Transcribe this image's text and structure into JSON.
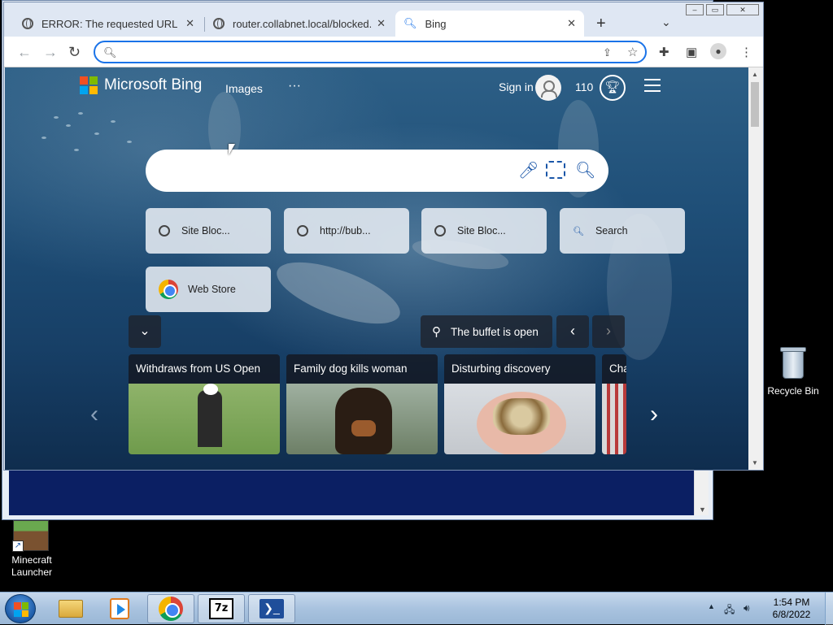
{
  "browser": {
    "tabs": [
      {
        "title": "ERROR: The requested URL could",
        "active": false
      },
      {
        "title": "router.collabnet.local/blocked.pl",
        "active": false
      },
      {
        "title": "Bing",
        "active": true
      }
    ],
    "new_tab_label": "+",
    "omnibox": {
      "value": "",
      "placeholder": ""
    }
  },
  "bing": {
    "brand": "Microsoft Bing",
    "nav_images": "Images",
    "nav_more": "···",
    "sign_in": "Sign in",
    "points": "110",
    "search_placeholder": "",
    "quick_links": [
      {
        "label": "Site Bloc...",
        "icon": "globe-icon"
      },
      {
        "label": "http://bub...",
        "icon": "globe-icon"
      },
      {
        "label": "Site Bloc...",
        "icon": "globe-icon"
      },
      {
        "label": "Search",
        "icon": "search-icon"
      },
      {
        "label": "Web Store",
        "icon": "chrome-icon"
      }
    ],
    "caption": "The buffet is open",
    "news": [
      {
        "headline": "Withdraws from US Open"
      },
      {
        "headline": "Family dog kills woman"
      },
      {
        "headline": "Disturbing discovery"
      },
      {
        "headline": "Cha"
      }
    ],
    "colors": {
      "ms_red": "#f25022",
      "ms_green": "#7fba00",
      "ms_blue": "#00a4ef",
      "ms_yellow": "#ffb900"
    }
  },
  "desktop": {
    "recycle_bin": "Recycle Bin",
    "minecraft": "Minecraft Launcher"
  },
  "taskbar": {
    "apps": [
      "windows-explorer",
      "media-player",
      "chrome",
      "7-zip",
      "powershell"
    ],
    "time": "1:54 PM",
    "date": "6/8/2022"
  }
}
